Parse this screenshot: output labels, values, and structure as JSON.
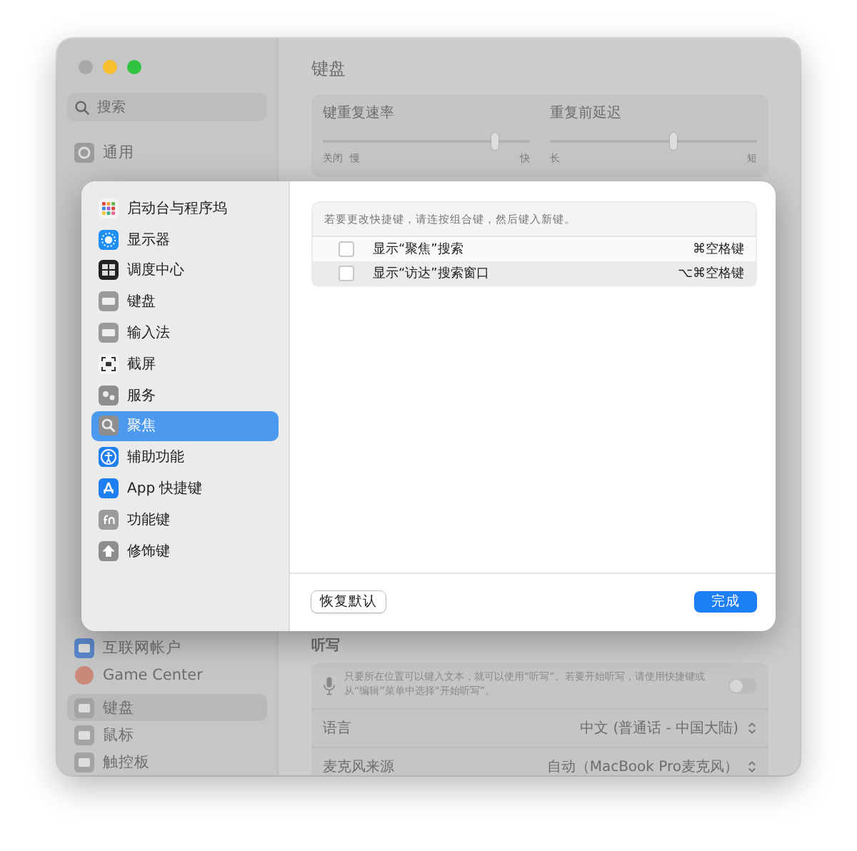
{
  "window": {
    "title": "键盘"
  },
  "sidebar": {
    "search": {
      "placeholder": "搜索"
    },
    "top_items": [
      {
        "label": "通用",
        "selected": false
      }
    ],
    "bottom_items": [
      {
        "label": "互联网帐户",
        "selected": false
      },
      {
        "label": "Game Center",
        "selected": false
      },
      {
        "label": "键盘",
        "selected": true
      },
      {
        "label": "鼠标",
        "selected": false
      },
      {
        "label": "触控板",
        "selected": false
      }
    ]
  },
  "sliders": [
    {
      "label": "键重复速率",
      "level": 0.83,
      "min_labels": [
        "关闭",
        "慢"
      ],
      "max_label": "快"
    },
    {
      "label": "重复前延迟",
      "level": 0.59,
      "min_labels": [
        "长"
      ],
      "max_label": "短"
    }
  ],
  "dictation": {
    "heading": "听写",
    "description": "只要所在位置可以键入文本，就可以使用“听写”。若要开始听写，请使用快捷键或从“编辑”菜单中选择“开始听写”。",
    "on": false
  },
  "settings": [
    {
      "label": "语言",
      "value": "中文 (普通话 - 中国大陆)"
    },
    {
      "label": "麦克风来源",
      "value": "自动（MacBook Pro麦克风）"
    }
  ],
  "sheet": {
    "categories": [
      {
        "label": "启动台与程序坞",
        "selected": false
      },
      {
        "label": "显示器",
        "selected": false
      },
      {
        "label": "调度中心",
        "selected": false
      },
      {
        "label": "键盘",
        "selected": false
      },
      {
        "label": "输入法",
        "selected": false
      },
      {
        "label": "截屏",
        "selected": false
      },
      {
        "label": "服务",
        "selected": false
      },
      {
        "label": "聚焦",
        "selected": true
      },
      {
        "label": "辅助功能",
        "selected": false
      },
      {
        "label": "App 快捷键",
        "selected": false
      },
      {
        "label": "功能键",
        "selected": false
      },
      {
        "label": "修饰键",
        "selected": false
      }
    ],
    "hint": "若要更改快捷键，请连按组合键，然后键入新键。",
    "shortcuts": [
      {
        "label": "显示“聚焦”搜索",
        "keys": "⌘空格键",
        "checked": false
      },
      {
        "label": "显示“访达”搜索窗口",
        "keys": "⌥⌘空格键",
        "checked": false
      }
    ],
    "buttons": [
      {
        "label": "恢复默认",
        "kind": "secondary"
      },
      {
        "label": "完成",
        "kind": "primary"
      }
    ]
  }
}
